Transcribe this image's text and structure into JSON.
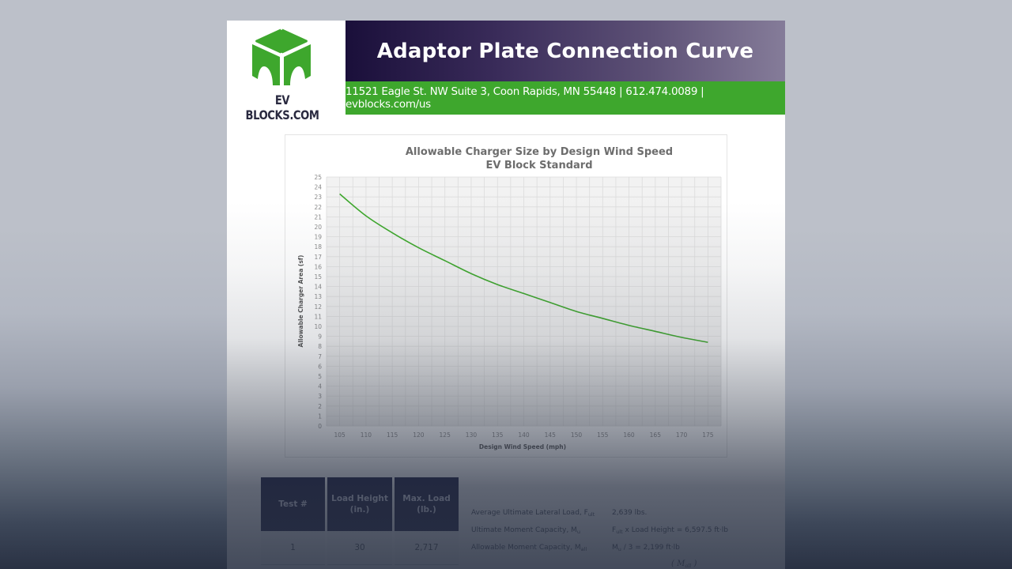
{
  "header": {
    "logo_text": "EV BLOCKS.COM",
    "logo_icon": "cube-block-icon",
    "title": "Adaptor Plate Connection Curve",
    "address": "11521 Eagle St. NW Suite 3, Coon Rapids, MN 55448 | 612.474.0089 | evblocks.com/us",
    "colors": {
      "brand_green": "#3ea72d",
      "title_dark": "#1a0f3a",
      "title_light": "#857c99"
    }
  },
  "chart_data": {
    "type": "line",
    "title": "Allowable Charger Size by Design Wind Speed",
    "subtitle": "EV Block Standard",
    "xlabel": "Design Wind Speed (mph)",
    "ylabel": "Allowable Charger Area (sf)",
    "x": [
      105,
      110,
      115,
      120,
      125,
      130,
      135,
      140,
      145,
      150,
      155,
      160,
      165,
      170,
      175
    ],
    "series": [
      {
        "name": "EV Block Standard",
        "color": "#3ea72d",
        "values": [
          23.3,
          21.1,
          19.4,
          17.9,
          16.6,
          15.3,
          14.2,
          13.3,
          12.4,
          11.5,
          10.8,
          10.1,
          9.5,
          8.9,
          8.4
        ]
      }
    ],
    "xticks": [
      "105",
      "110",
      "115",
      "120",
      "125",
      "130",
      "135",
      "140",
      "145",
      "150",
      "155",
      "160",
      "165",
      "170",
      "175"
    ],
    "yticks": [
      "0",
      "1",
      "2",
      "3",
      "4",
      "5",
      "6",
      "7",
      "8",
      "9",
      "10",
      "11",
      "12",
      "13",
      "14",
      "15",
      "16",
      "17",
      "18",
      "19",
      "20",
      "21",
      "22",
      "23",
      "24",
      "25"
    ],
    "xlim": [
      102.5,
      177.5
    ],
    "ylim": [
      0,
      25
    ],
    "grid": true,
    "legend": "none"
  },
  "table": {
    "headers": [
      "Test #",
      "Load Height\n(in.)",
      "Max. Load\n(lb.)"
    ],
    "header_lines": [
      [
        "Test #"
      ],
      [
        "Load Height",
        "(in.)"
      ],
      [
        "Max. Load",
        "(lb.)"
      ]
    ],
    "rows": [
      [
        "1",
        "30",
        "2,717"
      ]
    ]
  },
  "calculations": [
    {
      "label": "Average Ultimate Lateral Load, F",
      "label_sub": "ult",
      "value": "2,639 lbs.",
      "value_prefix": "",
      "value_prefix_sub": ""
    },
    {
      "label": "Ultimate Moment Capacity, M",
      "label_sub": "u",
      "value": " x Load Height = 6,597.5 ft·lb",
      "value_prefix": "F",
      "value_prefix_sub": "ult"
    },
    {
      "label": "Allowable Moment Capacity, M",
      "label_sub": "all",
      "value": " / 3 = 2,199 ft·lb",
      "value_prefix": "M",
      "value_prefix_sub": "u"
    }
  ],
  "formula_partial": "( M",
  "formula_partial_sub": "all",
  "formula_partial_end": " )"
}
